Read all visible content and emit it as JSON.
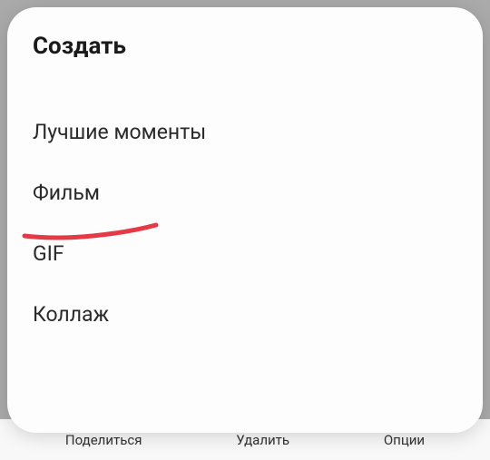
{
  "modal": {
    "title": "Создать",
    "items": [
      {
        "label": "Лучшие моменты"
      },
      {
        "label": "Фильм"
      },
      {
        "label": "GIF"
      },
      {
        "label": "Коллаж"
      }
    ]
  },
  "background_actions": {
    "share": "Поделиться",
    "delete": "Удалить",
    "options": "Опции"
  },
  "annotation": {
    "color": "#e63946"
  }
}
